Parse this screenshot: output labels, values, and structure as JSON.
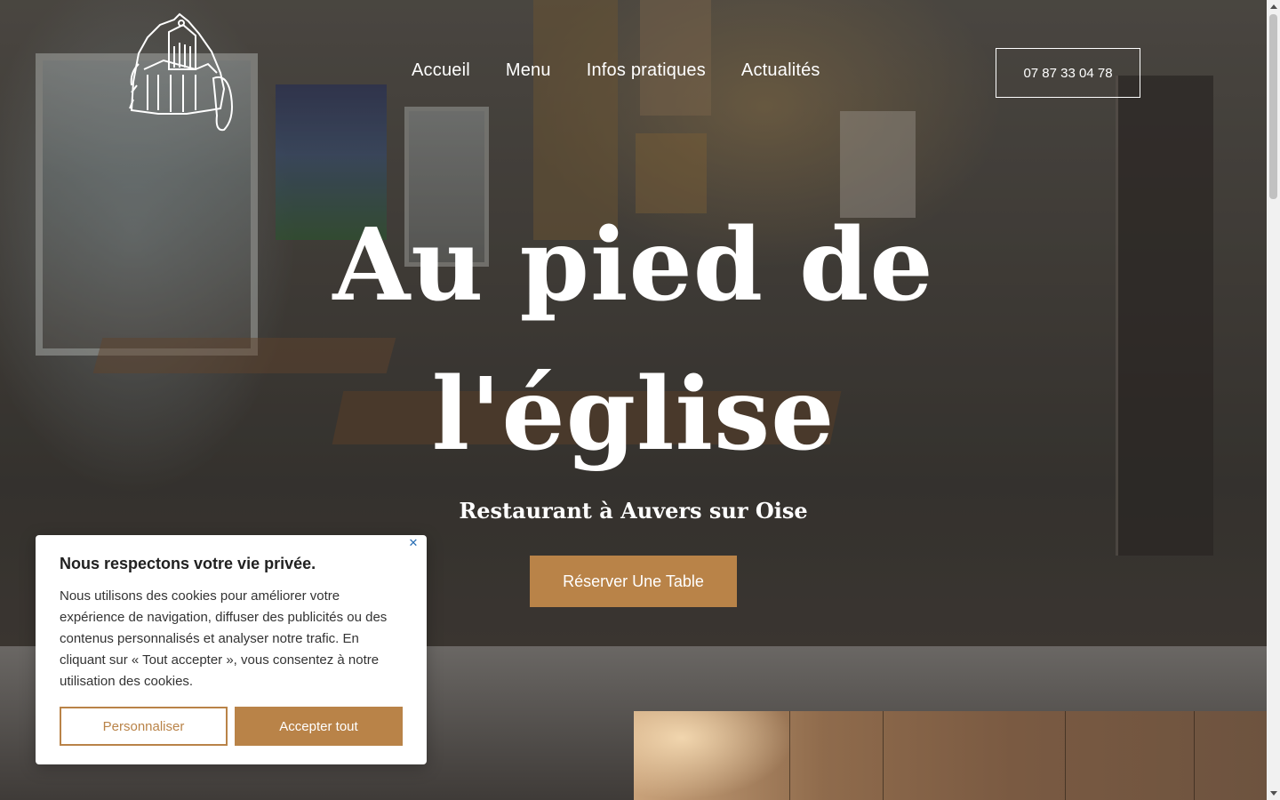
{
  "header": {
    "nav": [
      {
        "label": "Accueil"
      },
      {
        "label": "Menu"
      },
      {
        "label": "Infos pratiques"
      },
      {
        "label": "Actualités"
      }
    ],
    "phone": "07 87 33 04 78"
  },
  "hero": {
    "title_line1": "Au pied de",
    "title_line2": "l'église",
    "subtitle": "Restaurant à Auvers sur Oise",
    "cta": "Réserver Une Table"
  },
  "cookie": {
    "title": "Nous respectons votre vie privée.",
    "text": "Nous utilisons des cookies pour améliorer votre expérience de navigation, diffuser des publicités ou des contenus personnalisés et analyser notre trafic. En cliquant sur « Tout accepter », vous consentez à notre utilisation des cookies.",
    "customize_label": "Personnaliser",
    "accept_label": "Accepter tout",
    "close_icon": "close-icon"
  },
  "colors": {
    "accent": "#b98348",
    "text_light": "#ffffff"
  }
}
